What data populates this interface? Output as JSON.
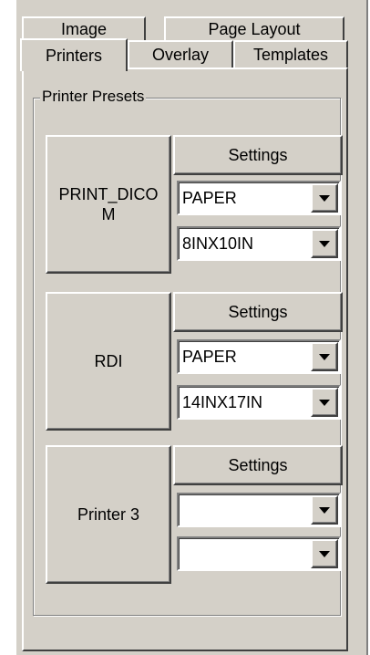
{
  "tabs": {
    "back_row": [
      "Image",
      "Page Layout"
    ],
    "front_row": [
      "Printers",
      "Overlay",
      "Templates"
    ],
    "active": "Printers"
  },
  "group": {
    "title": "Printer Presets"
  },
  "presets": [
    {
      "printer_label": "PRINT_DICOM",
      "settings_label": "Settings",
      "media": "PAPER",
      "size": "8INX10IN"
    },
    {
      "printer_label": "RDI",
      "settings_label": "Settings",
      "media": "PAPER",
      "size": "14INX17IN"
    },
    {
      "printer_label": "Printer 3",
      "settings_label": "Settings",
      "media": "",
      "size": ""
    }
  ],
  "icons": {
    "dropdown": "chevron-down-icon"
  },
  "colors": {
    "face": "#d4d0c8",
    "highlight": "#ffffff",
    "shadow": "#808080",
    "dark_shadow": "#404040"
  }
}
